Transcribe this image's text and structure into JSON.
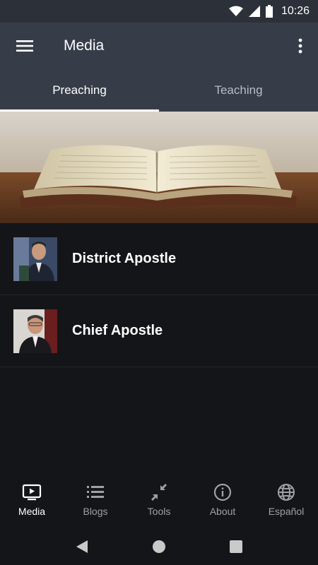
{
  "status_bar": {
    "time": "10:26"
  },
  "app_bar": {
    "title": "Media"
  },
  "tabs": [
    {
      "label": "Preaching",
      "active": true
    },
    {
      "label": "Teaching",
      "active": false
    }
  ],
  "list": [
    {
      "label": "District Apostle"
    },
    {
      "label": "Chief Apostle"
    }
  ],
  "bottom_nav": [
    {
      "label": "Media",
      "icon": "tv-play-icon",
      "active": true
    },
    {
      "label": "Blogs",
      "icon": "list-icon",
      "active": false
    },
    {
      "label": "Tools",
      "icon": "collapse-arrows-icon",
      "active": false
    },
    {
      "label": "About",
      "icon": "info-icon",
      "active": false
    },
    {
      "label": "Español",
      "icon": "globe-icon",
      "active": false
    }
  ],
  "colors": {
    "app_bar": "#373d48",
    "background": "#141518",
    "active_text": "#ffffff",
    "inactive_text": "#9da1a8"
  }
}
